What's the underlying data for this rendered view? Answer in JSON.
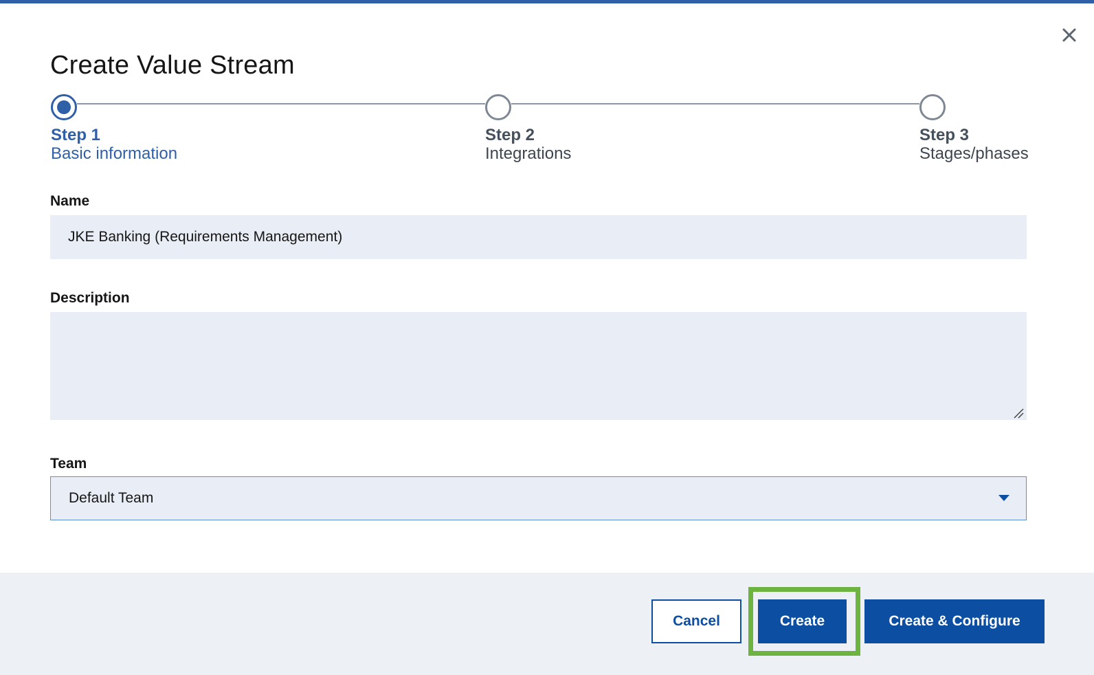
{
  "dialog": {
    "title": "Create Value Stream",
    "close_icon": "close-icon"
  },
  "stepper": {
    "steps": [
      {
        "label": "Step 1",
        "subtitle": "Basic information",
        "state": "active"
      },
      {
        "label": "Step 2",
        "subtitle": "Integrations",
        "state": "inactive"
      },
      {
        "label": "Step 3",
        "subtitle": "Stages/phases",
        "state": "inactive"
      }
    ]
  },
  "form": {
    "name_label": "Name",
    "name_value": "JKE Banking (Requirements Management)",
    "description_label": "Description",
    "description_value": "",
    "team_label": "Team",
    "team_value": "Default Team"
  },
  "footer": {
    "cancel_label": "Cancel",
    "create_label": "Create",
    "create_configure_label": "Create & Configure"
  },
  "colors": {
    "accent": "#2f5fa6",
    "primary_button": "#0b4ea2",
    "highlight": "#6db33f",
    "field_bg": "#e9edf5"
  }
}
